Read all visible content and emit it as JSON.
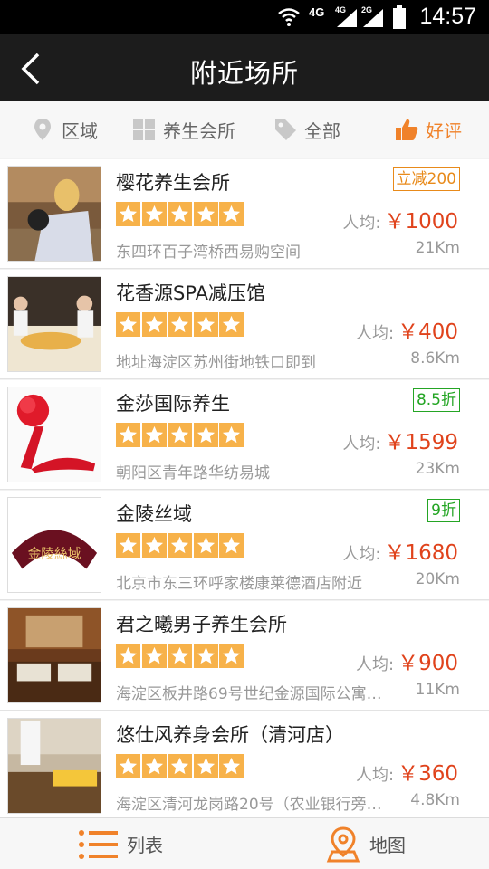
{
  "status_bar": {
    "time": "14:57",
    "network_primary": "4G",
    "network_sim1": "4G",
    "network_sim2": "2G"
  },
  "header": {
    "title": "附近场所",
    "back_icon": "chevron-left-icon"
  },
  "filters": [
    {
      "label": "区域",
      "icon": "location-pin-icon"
    },
    {
      "label": "养生会所",
      "icon": "grid-category-icon"
    },
    {
      "label": "全部",
      "icon": "tag-icon"
    },
    {
      "label": "好评",
      "icon": "thumbs-up-icon",
      "active": true
    }
  ],
  "price_label": "人均:",
  "venues": [
    {
      "name": "樱花养生会所",
      "badge": "立减200",
      "badge_color": "orange",
      "rating": 5,
      "price": "￥1000",
      "address": "东四环百子湾桥西易购空间",
      "distance": "21Km"
    },
    {
      "name": "花香源SPA减压馆",
      "badge": "",
      "badge_color": "",
      "rating": 5,
      "price": "￥400",
      "address": "地址海淀区苏州街地铁口即到",
      "distance": "8.6Km"
    },
    {
      "name": "金莎国际养生",
      "badge": "8.5折",
      "badge_color": "green",
      "rating": 5,
      "price": "￥1599",
      "address": "朝阳区青年路华纺易城",
      "distance": "23Km"
    },
    {
      "name": "金陵丝域",
      "badge": "9折",
      "badge_color": "green",
      "rating": 5,
      "price": "￥1680",
      "address": "北京市东三环呼家楼康莱德酒店附近",
      "distance": "20Km"
    },
    {
      "name": "君之曦男子养生会所",
      "badge": "",
      "badge_color": "",
      "rating": 5,
      "price": "￥900",
      "address": "海淀区板井路69号世纪金源国际公寓…",
      "distance": "11Km"
    },
    {
      "name": "悠仕风养身会所（清河店）",
      "badge": "",
      "badge_color": "",
      "rating": 5,
      "price": "￥360",
      "address": "海淀区清河龙岗路20号（农业银行旁…",
      "distance": "4.8Km"
    }
  ],
  "thumb_logo_text": "金陵絲域",
  "bottom_tabs": [
    {
      "label": "列表",
      "icon": "list-icon"
    },
    {
      "label": "地图",
      "icon": "map-pin-icon"
    }
  ],
  "colors": {
    "accent": "#f0822a",
    "price": "#e0431c",
    "star_bg": "#f7b24a",
    "badge_green": "#24a524",
    "badge_orange": "#e88a1a",
    "header_bg": "#1c1c1c"
  }
}
